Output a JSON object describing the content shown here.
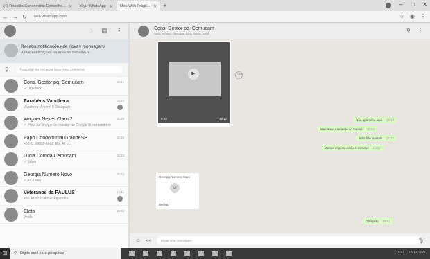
{
  "browser": {
    "tabs": [
      {
        "label": "(4) Reunião Condomínio Conselho...",
        "active": false
      },
      {
        "label": "ekyu WhatsApp",
        "active": false
      },
      {
        "label": "Meu Web Frágil...",
        "active": true
      }
    ],
    "url": "web.whatsapp.com"
  },
  "sidebar": {
    "notification": {
      "title": "Receba notificações de novas mensagens",
      "subtitle": "Ativar notificações na área de trabalho >"
    },
    "search_placeholder": "Pesquisar ou começar uma nova conversa",
    "chats": [
      {
        "name": "Cons. Gestor pq. Cemucam",
        "preview": "✓ Digitando...",
        "time": "15:41",
        "bold": false,
        "badge": false
      },
      {
        "name": "Parabéns Vandhera",
        "preview": "Vandhera: Amém! 6 Divulgado!",
        "time": "15:40",
        "bold": true,
        "badge": true
      },
      {
        "name": "Wagner Neves Claro 2",
        "preview": "✓ Previ na fim que de mostrar no Google Street também",
        "time": "15:39",
        "bold": false,
        "badge": false
      },
      {
        "name": "Papo Condominial GrandeSP",
        "preview": "+55 11 99999-9999: Em 40 p...",
        "time": "15:35",
        "bold": false,
        "badge": false
      },
      {
        "name": "Lúcia Corrida Cemucam",
        "preview": "✓ Valeu",
        "time": "15:33",
        "bold": false,
        "badge": false
      },
      {
        "name": "Georgia Numero Novo",
        "preview": "✓ Ao 2 min",
        "time": "15:22",
        "bold": false,
        "badge": false
      },
      {
        "name": "Veteranos da PAULUS",
        "preview": "+55 44 9732-4354: Figurinha",
        "time": "15:11",
        "bold": true,
        "badge": true
      },
      {
        "name": "Cleto",
        "preview": "Vinde",
        "time": "15:08",
        "bold": false,
        "badge": false
      }
    ]
  },
  "conversation": {
    "title": "Cons. Gestor pq. Cemucam",
    "subtitle": "Aldo, Aloisio, Georgia, Luiz, Maria, você",
    "video_duration": "0:35",
    "video_time": "15:11",
    "outgoing": [
      {
        "text": "Não apareceu aqui",
        "time": "15:17"
      },
      {
        "text": "Mas ate o momento só tem só",
        "time": "15:17"
      },
      {
        "text": "Não fale quase!!",
        "time": "15:17"
      },
      {
        "text": "Vamos esperar então 5 minutos",
        "time": "15:17"
      },
      {
        "text": "Obrigado",
        "time": "15:41"
      }
    ],
    "sticker_title": "Georgia Numero Novo",
    "sticker_caption": "Bereta",
    "compose_placeholder": "Digite uma mensagem"
  },
  "taskbar": {
    "search_text": "Digite aqui para pesquisar",
    "time": "15:41",
    "date": "15/11/2021"
  }
}
